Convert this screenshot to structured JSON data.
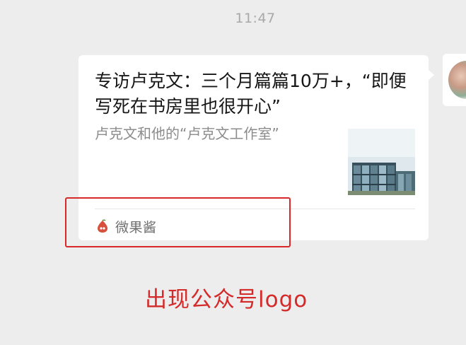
{
  "chat": {
    "timestamp": "11:47"
  },
  "message_card": {
    "title": "专访卢克文：三个月篇篇10万+，“即便写死在书房里也很开心”",
    "subtitle": "卢克文和他的“卢克文工作室”",
    "source_name": "微果酱",
    "source_icon": "weiguojiang-logo-icon"
  },
  "annotation": {
    "text": "出现公众号logo",
    "color": "#d42a2a"
  },
  "colors": {
    "background": "#ededed",
    "card": "#ffffff",
    "highlight": "#d9282a"
  }
}
